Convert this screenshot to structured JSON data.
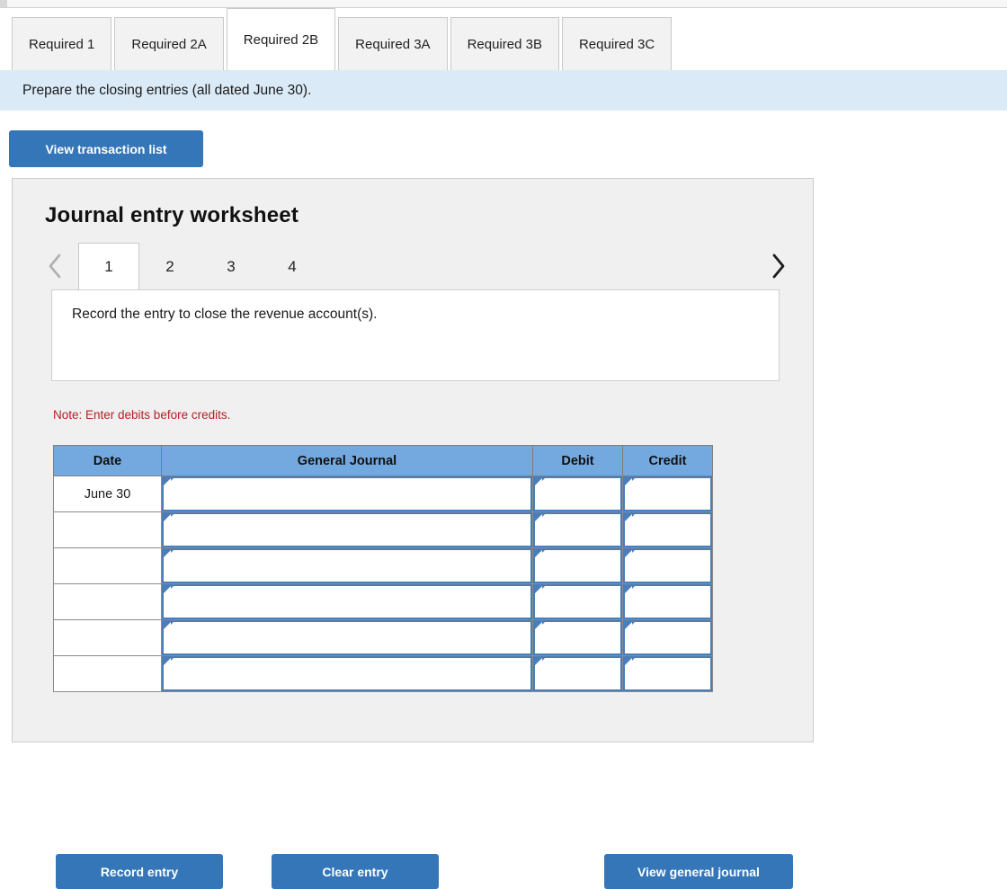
{
  "tabs": [
    {
      "label": "Required 1",
      "active": false
    },
    {
      "label": "Required 2A",
      "active": false
    },
    {
      "label": "Required 2B",
      "active": true
    },
    {
      "label": "Required 3A",
      "active": false
    },
    {
      "label": "Required 3B",
      "active": false
    },
    {
      "label": "Required 3C",
      "active": false
    }
  ],
  "banner": {
    "text": "Prepare the closing entries (all dated June 30)."
  },
  "toolbar": {
    "view_transaction_list": "View transaction list"
  },
  "panel": {
    "title": "Journal entry worksheet",
    "pager": {
      "prev_icon": "chevron-left-icon",
      "next_icon": "chevron-right-icon",
      "pages": [
        "1",
        "2",
        "3",
        "4"
      ],
      "active_page": "1"
    },
    "prompt": "Record the entry to close the revenue account(s).",
    "note": "Note: Enter debits before credits.",
    "table": {
      "headers": [
        "Date",
        "General Journal",
        "Debit",
        "Credit"
      ],
      "rows": [
        {
          "date": "June 30",
          "general_journal": "",
          "debit": "",
          "credit": ""
        },
        {
          "date": "",
          "general_journal": "",
          "debit": "",
          "credit": ""
        },
        {
          "date": "",
          "general_journal": "",
          "debit": "",
          "credit": ""
        },
        {
          "date": "",
          "general_journal": "",
          "debit": "",
          "credit": ""
        },
        {
          "date": "",
          "general_journal": "",
          "debit": "",
          "credit": ""
        },
        {
          "date": "",
          "general_journal": "",
          "debit": "",
          "credit": ""
        }
      ]
    },
    "actions": {
      "record_entry": "Record entry",
      "clear_entry": "Clear entry",
      "view_general_journal": "View general journal"
    }
  },
  "colors": {
    "accent_blue": "#3476b8",
    "table_header_blue": "#74a9e0",
    "banner_blue": "#daeaf7",
    "input_border_blue": "#4a7ebb",
    "note_red": "#b42025",
    "panel_gray": "#f0f0f0"
  }
}
